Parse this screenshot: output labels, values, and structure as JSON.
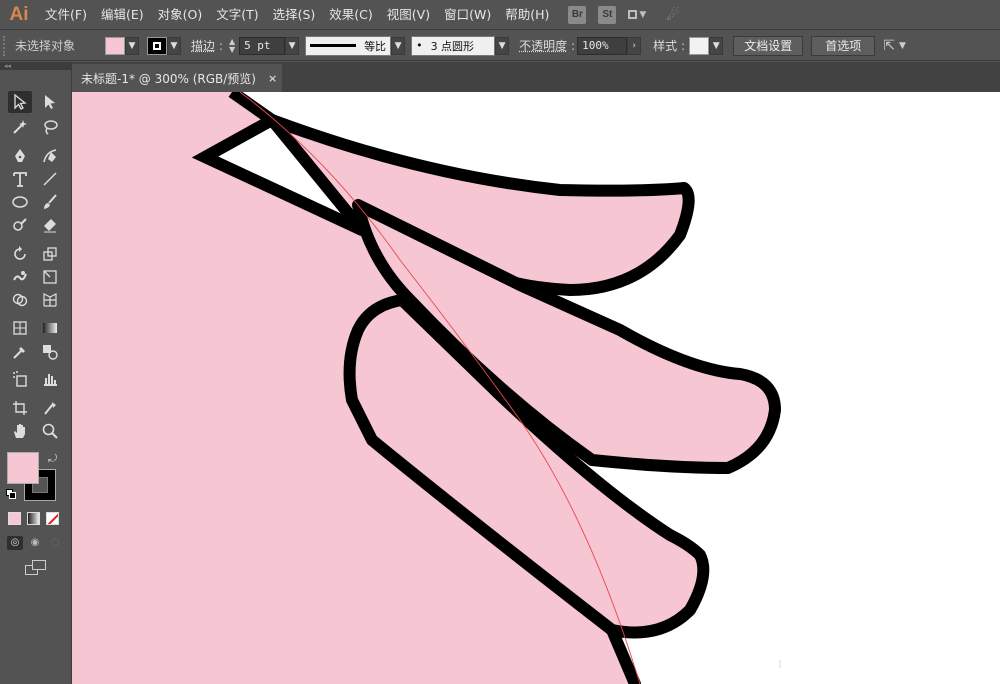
{
  "app": {
    "logo_text": "Ai",
    "menu": [
      "文件(F)",
      "编辑(E)",
      "对象(O)",
      "文字(T)",
      "选择(S)",
      "效果(C)",
      "视图(V)",
      "窗口(W)",
      "帮助(H)"
    ],
    "bridge_label": "Br",
    "stock_label": "St"
  },
  "control": {
    "selection_status": "未选择对象",
    "fill_color": "#f7c6d3",
    "stroke_color": "#000000",
    "stroke_label": "描边",
    "stroke_weight": "5 pt",
    "profile_label": "等比",
    "brush_label": "3 点圆形",
    "brush_dot": "•",
    "opacity_label": "不透明度",
    "opacity_value": "100%",
    "style_label": "样式",
    "doc_setup_button": "文档设置",
    "prefs_button": "首选项"
  },
  "document": {
    "tab_title": "未标题-1* @ 300% (RGB/预览)",
    "close_glyph": "×"
  },
  "artwork": {
    "fill": "#f7c6d3",
    "outline": "#000000",
    "guide_color": "#e8474c"
  },
  "tools": {
    "fill_swatch": "#f7c6d3",
    "stroke_swatch": "#000000"
  }
}
